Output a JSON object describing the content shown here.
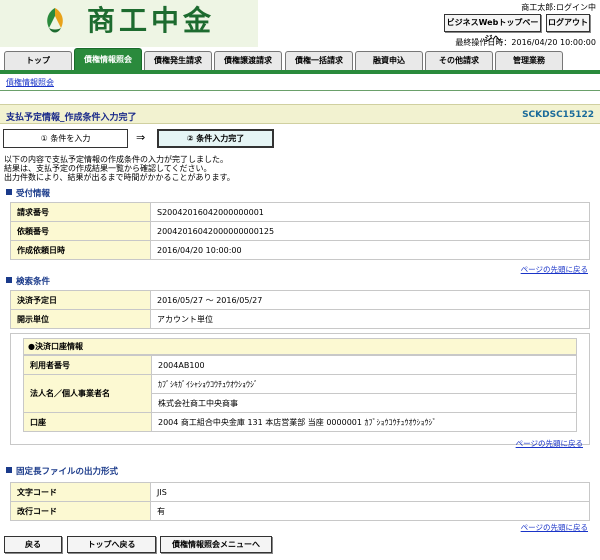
{
  "header": {
    "logo_text": "商工中金",
    "user_status": "商工太郎:ログイン中",
    "web_top_button": "ビジネスWebトップページへ",
    "logout_button": "ログアウト",
    "last_operation": "最終操作日時：2016/04/20 10:00:00"
  },
  "tabs": [
    {
      "label": "トップ"
    },
    {
      "label": "債権情報照会"
    },
    {
      "label": "債権発生請求"
    },
    {
      "label": "債権譲渡請求"
    },
    {
      "label": "債権一括請求"
    },
    {
      "label": "融資申込"
    },
    {
      "label": "その他請求"
    },
    {
      "label": "管理業務"
    }
  ],
  "subnav": {
    "link": "債権情報照会"
  },
  "page": {
    "title": "支払予定情報_作成条件入力完了",
    "screen_id": "SCKDSC15122"
  },
  "steps": {
    "step1": "① 条件を入力",
    "arrow": "⇒",
    "step2": "② 条件入力完了"
  },
  "messages": [
    "以下の内容で支払予定情報の作成条件の入力が完了しました。",
    "結果は、支払予定の作成結果一覧から確認してください。",
    "出力件数により、結果が出るまで時間がかかることがあります。"
  ],
  "reception": {
    "heading": "受付情報",
    "rows": [
      {
        "label": "請求番号",
        "value": "S20042016042000000001"
      },
      {
        "label": "依頼番号",
        "value": "20042016042000000000125"
      },
      {
        "label": "作成依頼日時",
        "value": "2016/04/20 10:00:00"
      }
    ]
  },
  "search": {
    "heading": "検索条件",
    "rows": [
      {
        "label": "決済予定日",
        "value": "2016/05/27 〜 2016/05/27"
      },
      {
        "label": "開示単位",
        "value": "アカウント単位"
      }
    ],
    "account_box": {
      "heading": "●決済口座情報",
      "user_number_label": "利用者番号",
      "user_number_value": "2004AB100",
      "name_label": "法人名／個人事業者名",
      "name_kana": "ｶﾌﾞｼｷｶﾞｲｼｬｼｮｳｺｳﾁｭｳｵｳｼｮｳｼﾞ",
      "name_kanji": "株式会社商工中央商事",
      "account_label": "口座",
      "account_value": "2004 商工組合中央金庫 131 本店営業部 当座 0000001 ｶﾌﾞｼｮｳｺｳﾁｭｳｵｳｼｮｳｼﾞ"
    }
  },
  "fixed_output": {
    "heading": "固定長ファイルの出力形式",
    "rows": [
      {
        "label": "文字コード",
        "value": "JIS"
      },
      {
        "label": "改行コード",
        "value": "有"
      }
    ]
  },
  "page_top_link": "ページの先頭に戻る",
  "footer": {
    "back_button": "戻る",
    "top_button": "トップへ戻る",
    "menu_button": "債権情報照会メニューへ"
  },
  "colors": {
    "brand_green": "#2a8a3c",
    "label_bg": "#fcf9d2",
    "title_bg": "#f2f2d0",
    "heading_blue": "#1a3a8a",
    "link_blue": "#1a34c8"
  }
}
